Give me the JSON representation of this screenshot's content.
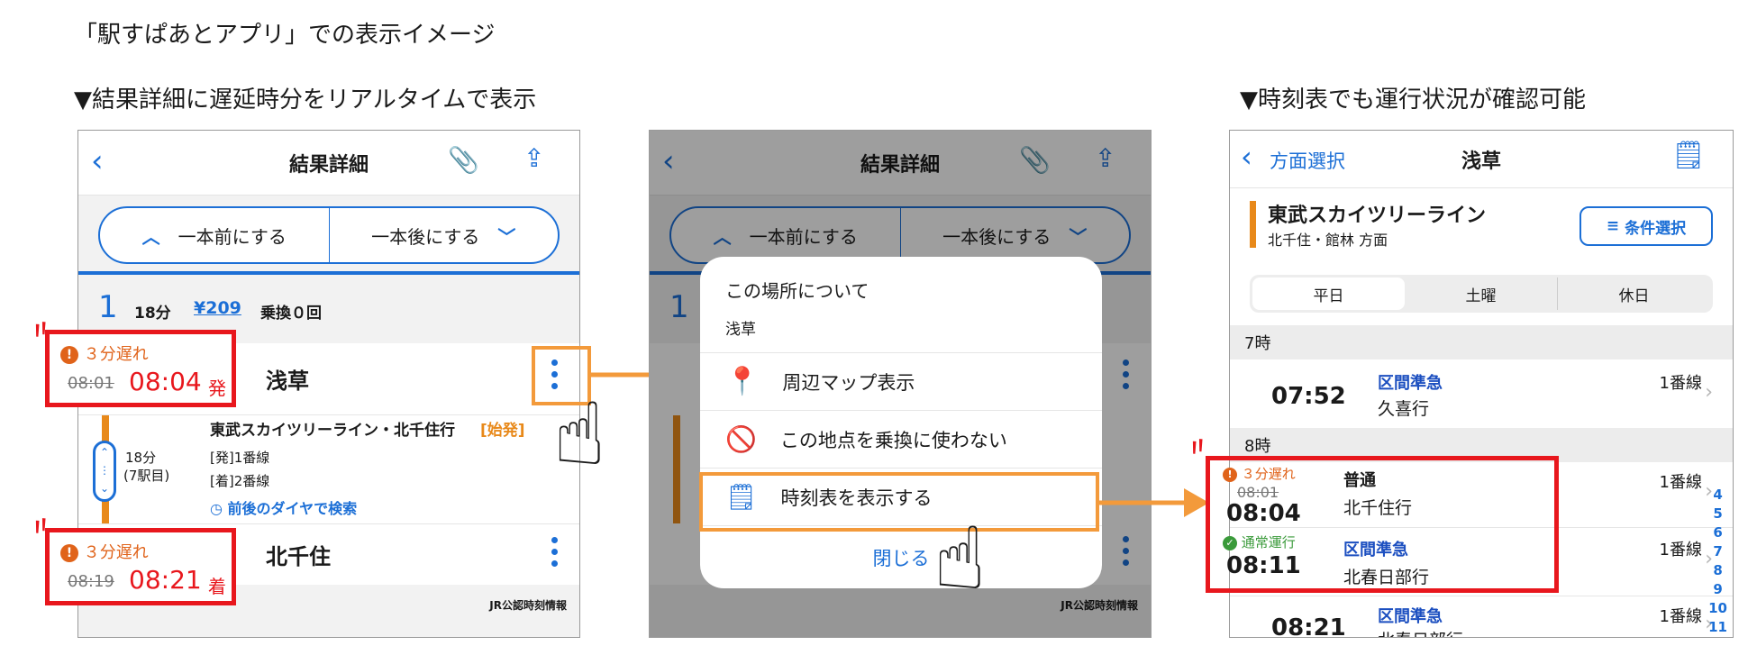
{
  "captions": {
    "top": "「駅すぱあとアプリ」での表示イメージ",
    "left": "▼結果詳細に遅延時分をリアルタイムで表示",
    "right": "▼時刻表でも運行状況が確認可能"
  },
  "screen1": {
    "title": "結果詳細",
    "prev_label": "一本前にする",
    "next_label": "一本後にする",
    "route_no": "1",
    "duration": "18分",
    "fare": "¥209",
    "transfer": "乗換０回",
    "dep": {
      "delay": "３分遅れ",
      "sched": "08:01",
      "actual": "08:04",
      "kind": "発",
      "station": "浅草"
    },
    "line_name": "東武スカイツリーライン・北千住行",
    "line_tag": "[始発]",
    "ride_time": "18分",
    "ride_stations": "(7駅目)",
    "dep_platform": "[発]1番線",
    "arr_platform": "[着]2番線",
    "search_link": "前後のダイヤで検索",
    "arr": {
      "delay": "３分遅れ",
      "sched": "08:19",
      "actual": "08:21",
      "kind": "着",
      "station": "北千住"
    },
    "footer": "JR公認時刻情報"
  },
  "screen2": {
    "title": "結果詳細",
    "prev_label": "一本前にする",
    "next_label": "一本後にする",
    "route_no": "1",
    "modal_header": "この場所について",
    "modal_place": "浅草",
    "menu": [
      "周辺マップ表示",
      "この地点を乗換に使わない",
      "時刻表を表示する"
    ],
    "close": "閉じる",
    "footer": "JR公認時刻情報"
  },
  "screen3": {
    "back_label": "方面選択",
    "title": "浅草",
    "line_name": "東武スカイツリーライン",
    "direction": "北千住・館林 方面",
    "filter_label": "条件選択",
    "tabs": [
      "平日",
      "土曜",
      "休日"
    ],
    "hour7": "7時",
    "hour8": "8時",
    "trains": [
      {
        "time": "07:52",
        "type": "区間準急",
        "dest": "久喜行",
        "platform": "1番線"
      },
      {
        "delay": "３分遅れ",
        "sched": "08:01",
        "time": "08:04",
        "type": "普通",
        "dest": "北千住行",
        "platform": "1番線"
      },
      {
        "status": "通常運行",
        "time": "08:11",
        "type": "区間準急",
        "dest": "北春日部行",
        "platform": "1番線"
      },
      {
        "time": "08:21",
        "type": "区間準急",
        "dest": "北春日部行",
        "platform": "1番線"
      }
    ],
    "hour_index": [
      "4",
      "5",
      "6",
      "7",
      "8",
      "9",
      "10",
      "11"
    ]
  },
  "colors": {
    "accent": "#1c6fd6",
    "alert": "#e8171d",
    "delay": "#e0631a",
    "highlight": "#f39a3b",
    "line": "#e8891a"
  }
}
